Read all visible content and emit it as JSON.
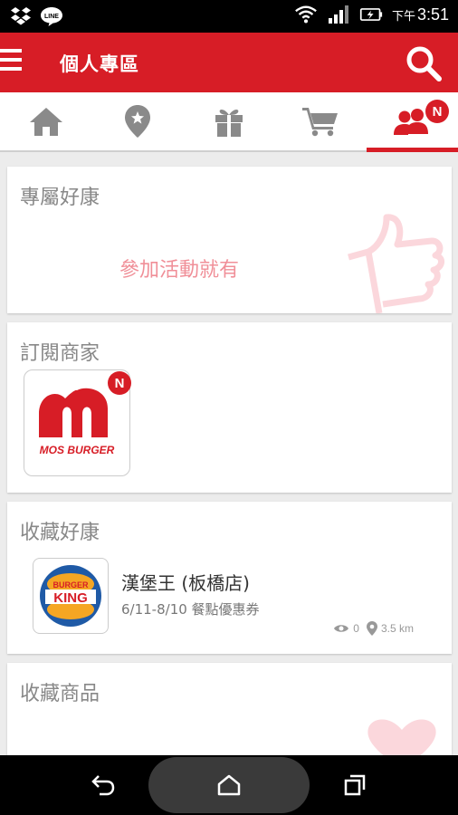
{
  "status_bar": {
    "time_prefix": "下午",
    "time": "3:51",
    "left_icons": [
      "dropbox-icon",
      "line-icon"
    ],
    "right_icons": [
      "wifi-icon",
      "signal-icon",
      "battery-icon"
    ]
  },
  "app_bar": {
    "title": "個人專區",
    "menu_icon": "hamburger-menu-icon",
    "search_icon": "search-icon",
    "color": "#d71d26"
  },
  "tabs": [
    {
      "icon": "home-icon",
      "active": false
    },
    {
      "icon": "location-star-icon",
      "active": false
    },
    {
      "icon": "gift-icon",
      "active": false
    },
    {
      "icon": "cart-icon",
      "active": false
    },
    {
      "icon": "users-icon",
      "active": true,
      "badge": "N"
    }
  ],
  "sections": {
    "exclusive": {
      "title": "專屬好康",
      "message": "參加活動就有",
      "decor_icon": "thumbs-up-icon"
    },
    "subscribed": {
      "title": "訂閱商家",
      "stores": [
        {
          "logo": "MOS BURGER",
          "badge": "N"
        }
      ]
    },
    "saved_deals": {
      "title": "收藏好康",
      "items": [
        {
          "logo": "BURGER KING",
          "name": "漢堡王 (板橋店)",
          "desc": "6/11-8/10 餐點優惠券",
          "views": "0",
          "distance": "3.5 km"
        }
      ]
    },
    "saved_products": {
      "title": "收藏商品"
    }
  },
  "nav_bar": {
    "icons": [
      "back-icon",
      "home-icon",
      "recents-icon"
    ]
  }
}
